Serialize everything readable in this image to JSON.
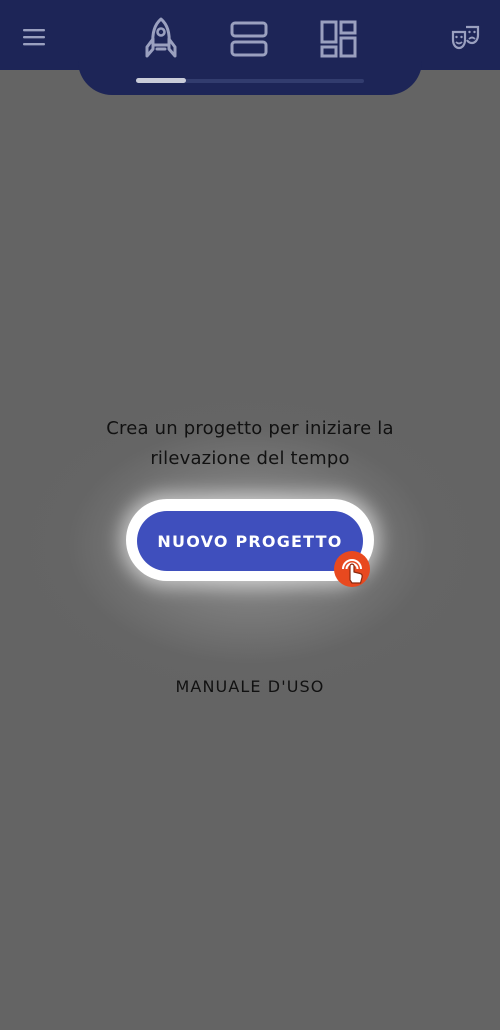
{
  "app_bar": {
    "menu_icon": "hamburger-menu-icon",
    "tabs": [
      {
        "icon": "rocket-icon",
        "selected": true
      },
      {
        "icon": "list-view-icon",
        "selected": false
      },
      {
        "icon": "dashboard-icon",
        "selected": false
      }
    ],
    "right_icon": "theater-masks-icon",
    "colors": {
      "bar": "#1d2557",
      "icon": "#9aa0bf",
      "indicator": "#c9ccd9"
    }
  },
  "empty_state": {
    "message": "Crea un progetto per iniziare la rilevazione del tempo",
    "primary_button_label": "NUOVO PROGETTO",
    "tap_hint_icon": "tap-hand-icon",
    "secondary_link_label": "MANUALE D'USO"
  },
  "colors": {
    "background_overlay": "#646464",
    "primary": "#3f4fbd",
    "tap_hint": "#e8491f"
  }
}
